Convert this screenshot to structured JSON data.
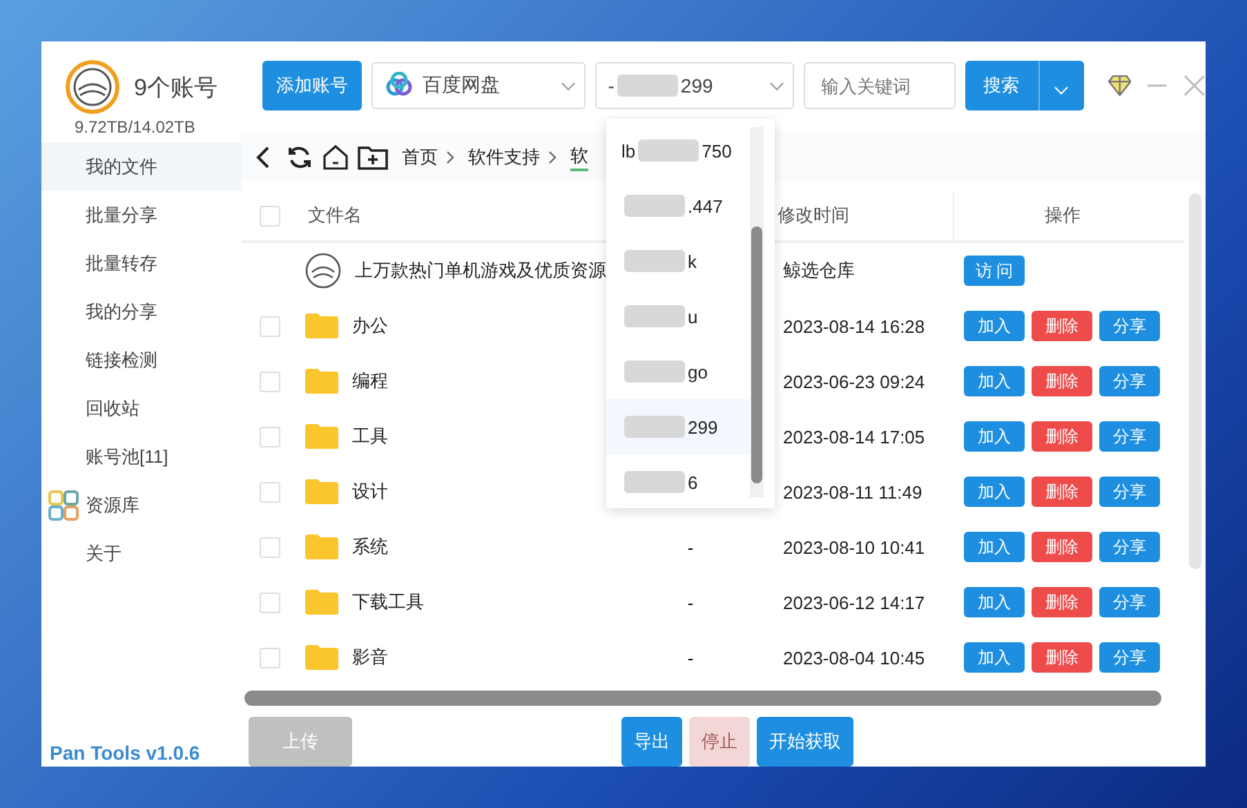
{
  "account": {
    "count_label": "9个账号",
    "storage": "9.72TB/14.02TB"
  },
  "toolbar": {
    "add_button": "添加账号",
    "drive_select": {
      "value": "百度网盘"
    },
    "account_select": {
      "prefix": "-",
      "suffix": "299"
    },
    "keyword": {
      "placeholder": "输入关键词"
    },
    "search_button": "搜索"
  },
  "sidebar": {
    "items": [
      {
        "label": "我的文件",
        "selected": true,
        "kind": "text"
      },
      {
        "label": "批量分享",
        "selected": false,
        "kind": "text"
      },
      {
        "label": "批量转存",
        "selected": false,
        "kind": "text"
      },
      {
        "label": "我的分享",
        "selected": false,
        "kind": "text"
      },
      {
        "label": "链接检测",
        "selected": false,
        "kind": "text"
      },
      {
        "label": "回收站",
        "selected": false,
        "kind": "text"
      },
      {
        "label": "账号池[11]",
        "selected": false,
        "kind": "text"
      },
      {
        "label": "资源库",
        "selected": false,
        "kind": "icon"
      },
      {
        "label": "关于",
        "selected": false,
        "kind": "text"
      }
    ],
    "footer": "Pan Tools v1.0.6"
  },
  "breadcrumb": [
    "首页",
    "软件支持",
    "软"
  ],
  "table": {
    "select_all_checked": false,
    "columns": [
      "文件名",
      "修改时间",
      "操作"
    ],
    "rows": [
      {
        "kind": "resource",
        "name": "上万款热门单机游戏及优质资源",
        "modified": "鲸选仓库",
        "actions": [
          "访 问"
        ]
      },
      {
        "kind": "folder",
        "name": "办公",
        "modified": "2023-08-14 16:28",
        "actions": [
          "加入",
          "删除",
          "分享"
        ],
        "checked": false
      },
      {
        "kind": "folder",
        "name": "编程",
        "modified": "2023-06-23 09:24",
        "actions": [
          "加入",
          "删除",
          "分享"
        ],
        "checked": false
      },
      {
        "kind": "folder",
        "name": "工具",
        "modified": "2023-08-14 17:05",
        "actions": [
          "加入",
          "删除",
          "分享"
        ],
        "checked": false
      },
      {
        "kind": "folder",
        "name": "设计",
        "modified": "2023-08-11 11:49",
        "actions": [
          "加入",
          "删除",
          "分享"
        ],
        "checked": false
      },
      {
        "kind": "folder",
        "name": "系统",
        "size": "-",
        "modified": "2023-08-10 10:41",
        "actions": [
          "加入",
          "删除",
          "分享"
        ],
        "checked": false
      },
      {
        "kind": "folder",
        "name": "下载工具",
        "size": "-",
        "modified": "2023-06-12 14:17",
        "actions": [
          "加入",
          "删除",
          "分享"
        ],
        "checked": false
      },
      {
        "kind": "folder",
        "name": "影音",
        "size": "-",
        "modified": "2023-08-04 10:45",
        "actions": [
          "加入",
          "删除",
          "分享"
        ],
        "checked": false
      }
    ]
  },
  "account_dropdown": {
    "expanded": true,
    "items": [
      {
        "prefix": "lb",
        "suffix": "750",
        "selected": false
      },
      {
        "suffix": ".447",
        "selected": false
      },
      {
        "suffix": "k",
        "selected": false
      },
      {
        "suffix": "u",
        "selected": false
      },
      {
        "suffix": "go",
        "selected": false
      },
      {
        "suffix": "299",
        "selected": true
      },
      {
        "suffix": "6",
        "selected": false
      }
    ]
  },
  "footer_buttons": [
    {
      "label": "上传",
      "kind": "grey",
      "disabled": false
    },
    {
      "label": "导出",
      "kind": "blue",
      "disabled": false
    },
    {
      "label": "停止",
      "kind": "blue",
      "disabled": true
    },
    {
      "label": "开始获取",
      "kind": "blue",
      "disabled": false
    }
  ]
}
